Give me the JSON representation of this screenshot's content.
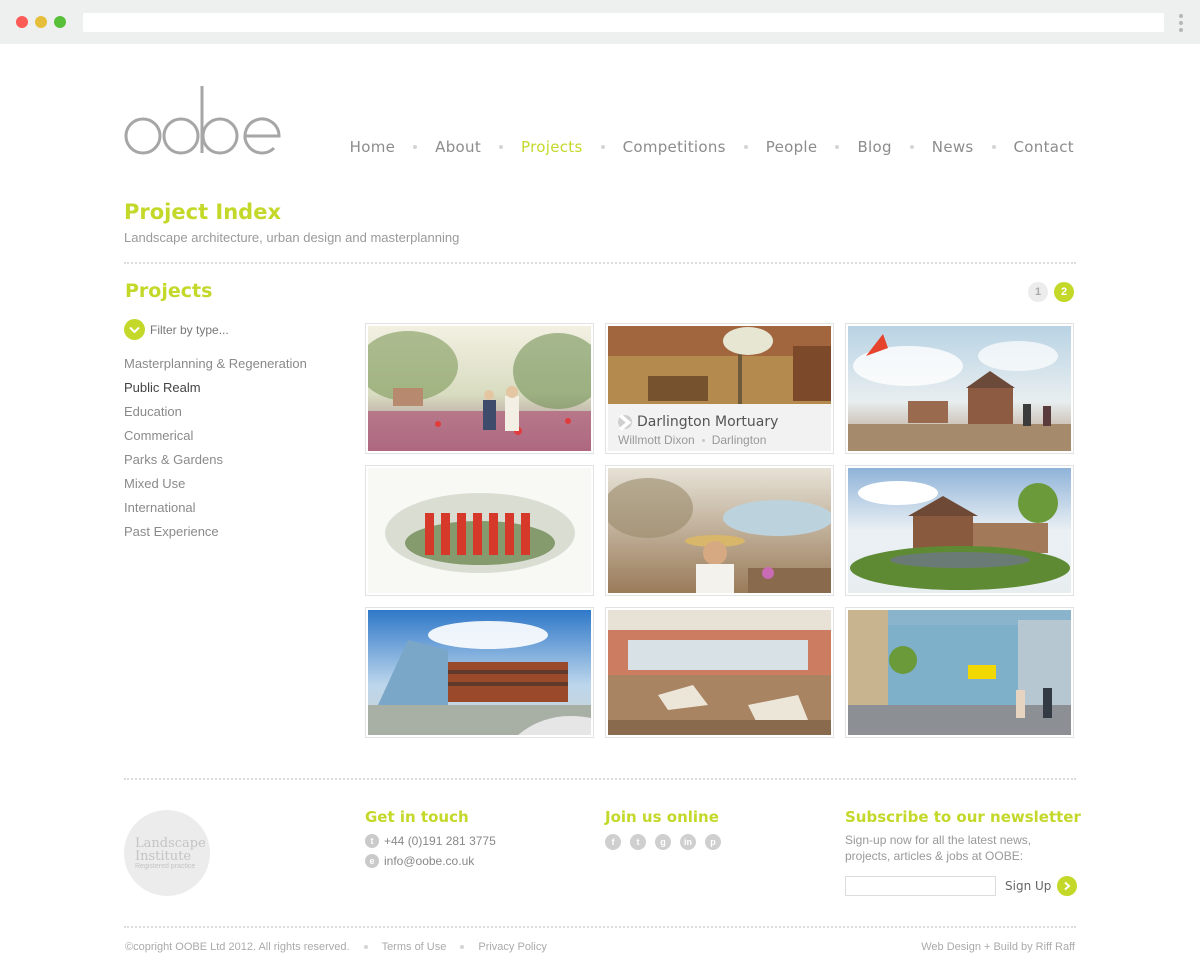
{
  "nav": {
    "items": [
      {
        "label": "Home"
      },
      {
        "label": "About"
      },
      {
        "label": "Projects",
        "active": true
      },
      {
        "label": "Competitions"
      },
      {
        "label": "People"
      },
      {
        "label": "Blog"
      },
      {
        "label": "News"
      },
      {
        "label": "Contact"
      }
    ]
  },
  "page": {
    "title": "Project Index",
    "subtitle": "Landscape architecture, urban design and masterplanning"
  },
  "sidebar": {
    "title": "Projects",
    "filter_label": "Filter by type...",
    "categories": [
      {
        "label": "Masterplanning & Regeneration"
      },
      {
        "label": "Public Realm",
        "current": true
      },
      {
        "label": "Education"
      },
      {
        "label": "Commerical"
      },
      {
        "label": "Parks & Gardens"
      },
      {
        "label": "Mixed Use"
      },
      {
        "label": "International"
      },
      {
        "label": "Past Experience"
      }
    ]
  },
  "pagination": {
    "pages": [
      "1",
      "2"
    ],
    "current": "2"
  },
  "grid": {
    "hovered": {
      "title": "Darlington Mortuary",
      "client": "Willmott Dixon",
      "location": "Darlington"
    }
  },
  "footer": {
    "badge_line1": "Landscape",
    "badge_line2": "Institute",
    "badge_line3": "Registered practice",
    "contact_title": "Get in touch",
    "phone_icon": "t",
    "phone": "+44 (0)191 281 3775",
    "email_icon": "e",
    "email": "info@oobe.co.uk",
    "social_title": "Join us online",
    "social_icons": [
      "f",
      "t",
      "g",
      "in",
      "p"
    ],
    "newsletter_title": "Subscribe to our newsletter",
    "newsletter_text": "Sign-up now for all the latest news, projects, articles & jobs at OOBE:",
    "signup_label": "Sign Up",
    "copyright": "©copright OOBE Ltd 2012. All rights reserved.",
    "terms": "Terms of Use",
    "privacy": "Privacy Policy",
    "credit": "Web Design + Build by Riff Raff"
  },
  "colors": {
    "accent": "#c4d82a",
    "text": "#888888"
  }
}
